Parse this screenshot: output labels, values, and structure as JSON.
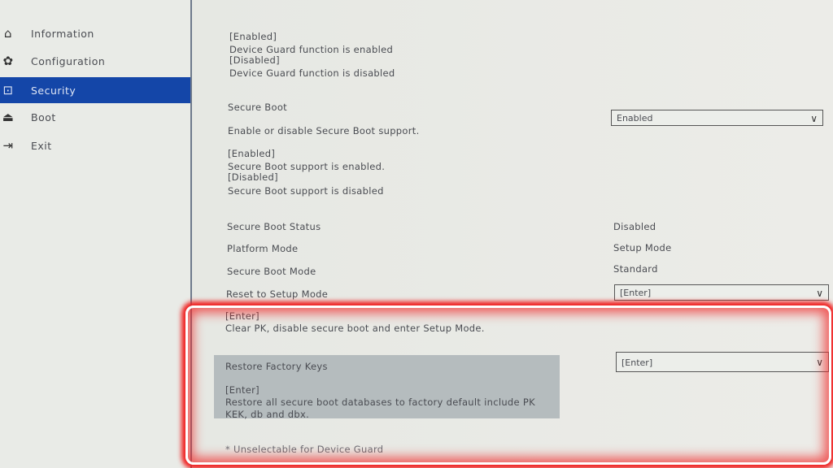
{
  "sidebar": {
    "items": [
      {
        "label": "Information",
        "icon": "home-icon"
      },
      {
        "label": "Configuration",
        "icon": "shapes-icon"
      },
      {
        "label": "Security",
        "icon": "lock-icon",
        "selected": true
      },
      {
        "label": "Boot",
        "icon": "boot-icon"
      },
      {
        "label": "Exit",
        "icon": "exit-icon"
      }
    ]
  },
  "main": {
    "device_guard_help": [
      "[Enabled]",
      "Device Guard function is enabled",
      "[Disabled]",
      "Device Guard function is disabled"
    ],
    "secure_boot": {
      "label": "Secure Boot",
      "value": "Enabled",
      "desc": "Enable or disable Secure Boot support.",
      "help": [
        "[Enabled]",
        "Secure Boot support is enabled.",
        "[Disabled]",
        "Secure Boot support is disabled"
      ]
    },
    "status": [
      {
        "label": "Secure Boot Status",
        "value": "Disabled"
      },
      {
        "label": "Platform Mode",
        "value": "Setup Mode"
      },
      {
        "label": "Secure Boot Mode",
        "value": "Standard"
      }
    ],
    "reset": {
      "label": "Reset to Setup Mode",
      "value": "[Enter]",
      "help": [
        "[Enter]",
        "Clear PK, disable secure boot and enter Setup Mode."
      ]
    },
    "restore": {
      "label": "Restore Factory Keys",
      "value": "[Enter]",
      "help": [
        "[Enter]",
        "Restore all secure boot databases to factory default include PK",
        "KEK, db and dbx."
      ]
    },
    "footnote": "* Unselectable for Device Guard"
  },
  "colors": {
    "selected": "#1446a8",
    "highlight": "#f02020"
  }
}
